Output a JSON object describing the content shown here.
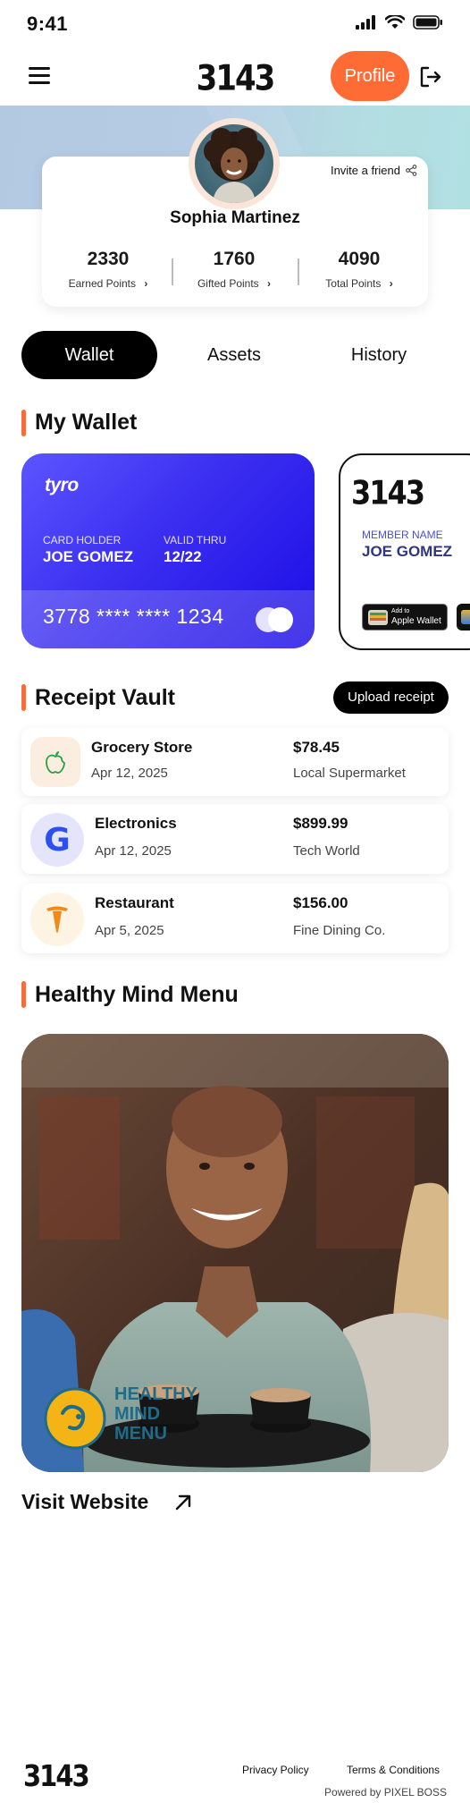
{
  "status_bar": {
    "time": "9:41"
  },
  "header": {
    "logo": "3143",
    "profile_button": "Profile"
  },
  "profile": {
    "invite_label": "Invite a friend",
    "name": "Sophia Martinez",
    "stats": [
      {
        "value": "2330",
        "label": "Earned Points"
      },
      {
        "value": "1760",
        "label": "Gifted Points"
      },
      {
        "value": "4090",
        "label": "Total Points"
      }
    ]
  },
  "tabs": [
    {
      "label": "Wallet",
      "active": true
    },
    {
      "label": "Assets",
      "active": false
    },
    {
      "label": "History",
      "active": false
    }
  ],
  "wallet": {
    "title": "My Wallet",
    "card": {
      "brand": "tyro",
      "holder_label": "CARD HOLDER",
      "holder": "JOE GOMEZ",
      "valid_label": "VALID THRU",
      "valid": "12/22",
      "number": "3778 **** **** 1234"
    },
    "member_card": {
      "logo": "3143",
      "member_label": "MEMBER NAME",
      "member_name": "JOE GOMEZ",
      "wallet_small": "Add to",
      "wallet_big": "Apple Wallet"
    }
  },
  "receipts": {
    "title": "Receipt Vault",
    "upload_button": "Upload receipt",
    "items": [
      {
        "name": "Grocery Store",
        "date": "Apr 12, 2025",
        "amount": "$78.45",
        "merchant": "Local Supermarket",
        "icon": "apple-icon"
      },
      {
        "name": "Electronics",
        "date": "Apr 12, 2025",
        "amount": "$899.99",
        "merchant": "Tech World",
        "icon": "google-icon"
      },
      {
        "name": "Restaurant",
        "date": "Apr 5, 2025",
        "amount": "$156.00",
        "merchant": "Fine Dining Co.",
        "icon": "tesla-icon"
      }
    ]
  },
  "healthy": {
    "title": "Healthy Mind Menu",
    "logo_lines": [
      "HEALTHY",
      "MIND",
      "MENU"
    ],
    "visit_label": "Visit Website"
  },
  "footer": {
    "logo": "3143",
    "privacy": "Privacy Policy",
    "terms": "Terms & Conditions",
    "powered": "Powered by PIXEL BOSS"
  },
  "colors": {
    "accent": "#ff6b35",
    "card_blue": "#2a1ff0",
    "dark": "#000000"
  }
}
